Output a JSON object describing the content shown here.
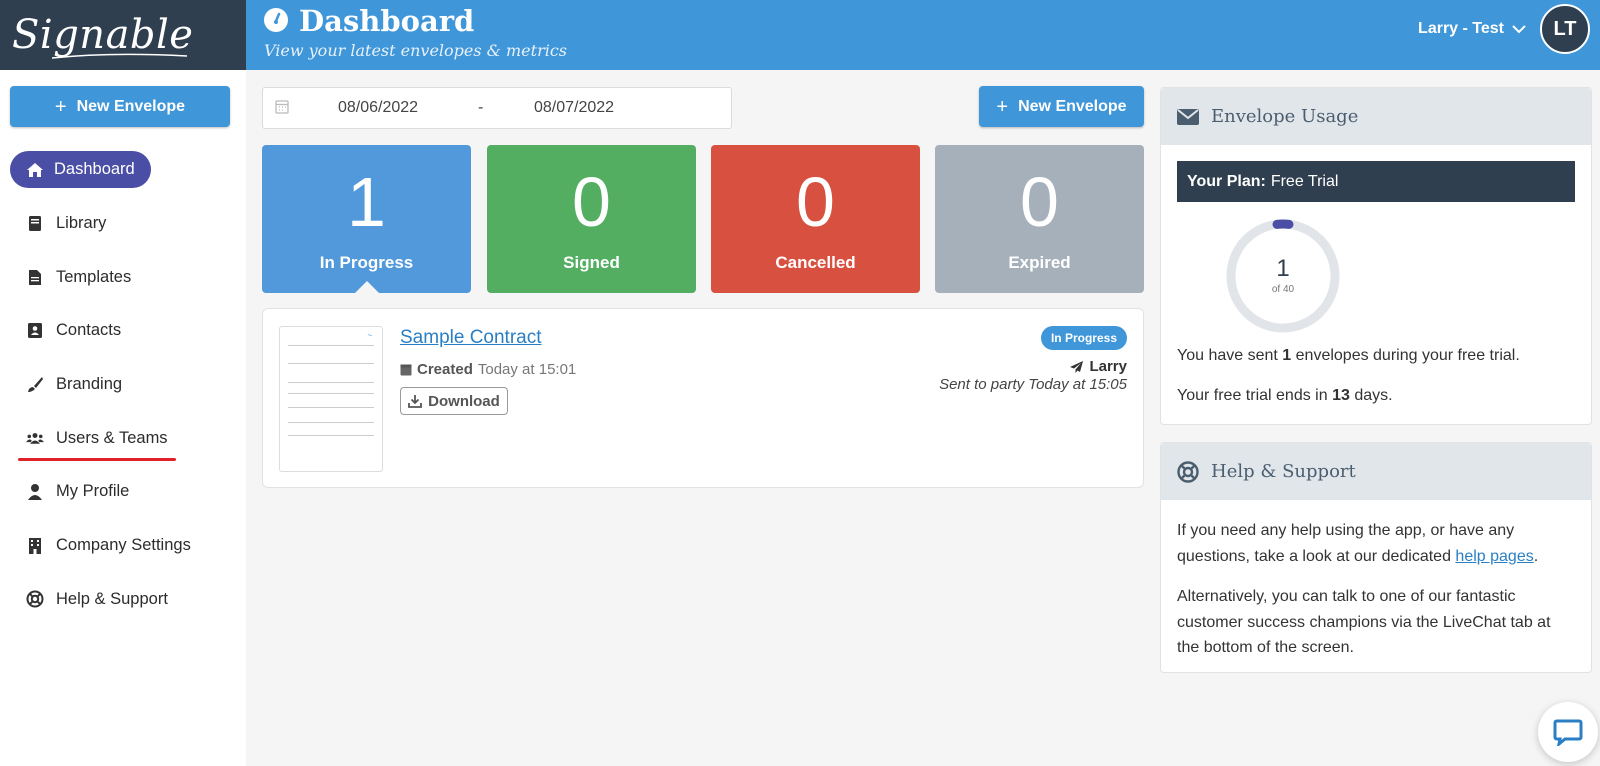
{
  "app": {
    "logo_text": "Signable"
  },
  "header": {
    "title": "Dashboard",
    "subtitle": "View your latest envelopes & metrics",
    "user_name": "Larry - Test",
    "avatar_initials": "LT"
  },
  "sidebar": {
    "new_envelope_label": "New Envelope",
    "items": [
      {
        "label": "Dashboard",
        "icon": "home-icon",
        "active": true
      },
      {
        "label": "Library",
        "icon": "book-icon"
      },
      {
        "label": "Templates",
        "icon": "file-icon"
      },
      {
        "label": "Contacts",
        "icon": "address-book-icon"
      },
      {
        "label": "Branding",
        "icon": "brush-icon"
      },
      {
        "label": "Users & Teams",
        "icon": "users-icon",
        "highlighted": true
      },
      {
        "label": "My Profile",
        "icon": "user-icon"
      },
      {
        "label": "Company Settings",
        "icon": "building-icon"
      },
      {
        "label": "Help & Support",
        "icon": "lifebuoy-icon"
      }
    ]
  },
  "filters": {
    "date_from": "08/06/2022",
    "date_separator": "-",
    "date_to": "08/07/2022"
  },
  "main": {
    "new_envelope_label": "New Envelope"
  },
  "stats": [
    {
      "value": "1",
      "label": "In Progress",
      "color": "#5199da"
    },
    {
      "value": "0",
      "label": "Signed",
      "color": "#54ae62"
    },
    {
      "value": "0",
      "label": "Cancelled",
      "color": "#d8503f"
    },
    {
      "value": "0",
      "label": "Expired",
      "color": "#a6b0ba"
    }
  ],
  "envelope": {
    "title": "Sample Contract",
    "created_label": "Created",
    "created_time": "Today at 15:01",
    "download_label": "Download",
    "status_badge": "In Progress",
    "sender": "Larry",
    "sent_info": "Sent to party Today at 15:05"
  },
  "usage_panel": {
    "title": "Envelope Usage",
    "plan_label": "Your Plan:",
    "plan_value": "Free Trial",
    "used": "1",
    "of_label": "of 40",
    "sent_prefix": "You have sent",
    "sent_count": "1",
    "sent_suffix": "envelopes during your free trial.",
    "ends_prefix": "Your free trial ends in",
    "ends_days": "13",
    "ends_suffix": "days."
  },
  "help_panel": {
    "title": "Help & Support",
    "p1_prefix": "If you need any help using the app, or have any questions, take a look at our dedicated",
    "p1_link": "help pages",
    "p1_suffix": ".",
    "p2": "Alternatively, you can talk to one of our fantastic customer success champions via the LiveChat tab at the bottom of the screen."
  },
  "colors": {
    "brand_blue": "#3f96d8",
    "dark_navy": "#2f3f4f",
    "active_purple": "#4a4ea5",
    "highlight_red": "#e0202a"
  }
}
